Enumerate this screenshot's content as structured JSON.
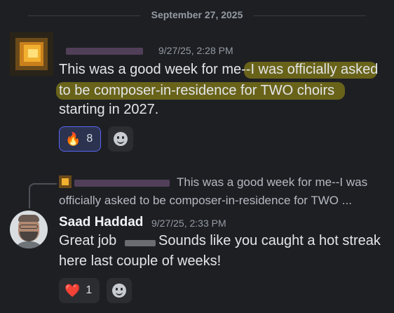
{
  "date_divider": "September 27, 2025",
  "message1": {
    "timestamp": "9/27/25, 2:28 PM",
    "line1": "This was a good week for me--I was officially asked",
    "line2": "to be composer-in-residence for TWO choirs",
    "line3": "starting in 2027.",
    "reactions": [
      {
        "emoji": "🔥",
        "emoji_name": "fire-icon",
        "count": "8"
      }
    ]
  },
  "message2": {
    "reply_preview_line1": "This was a good week for me--I was",
    "reply_preview_line2": "officially asked to be composer-in-residence for TWO ...",
    "username": "Saad Haddad",
    "timestamp": "9/27/25, 2:33 PM",
    "line1_start": "Great job",
    "line1_end": "Sounds like you caught a hot streak",
    "line2": "here last couple of weeks!",
    "reactions": [
      {
        "emoji": "❤️",
        "emoji_name": "heart-icon",
        "count": "1"
      }
    ]
  },
  "colors": {
    "background": "#1e1f23",
    "highlight": "#7a7318",
    "reaction_active_border": "#5865f2"
  }
}
